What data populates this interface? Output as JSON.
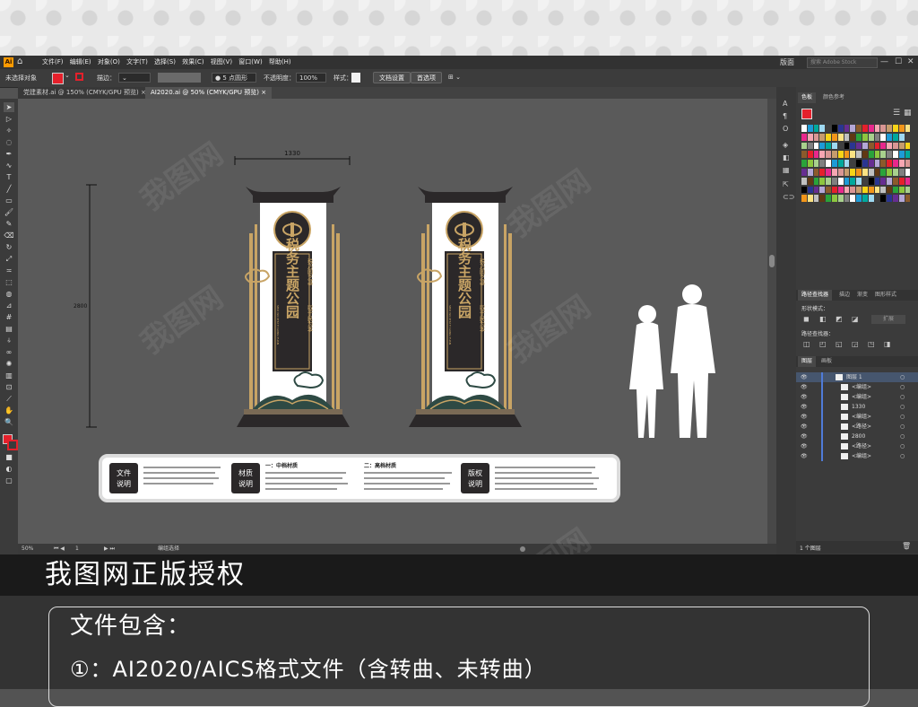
{
  "menubar": {
    "app_icon": "Ai",
    "menus": [
      "文件(F)",
      "编辑(E)",
      "对象(O)",
      "文字(T)",
      "选择(S)",
      "效果(C)",
      "视图(V)",
      "窗口(W)",
      "帮助(H)"
    ],
    "workspace": "版面",
    "stock_search_placeholder": "搜索 Adobe Stock"
  },
  "controlbar": {
    "selection_status": "未选择对象",
    "stroke_label": "描边：",
    "brush_label": "5 点圆形",
    "opacity_label": "不透明度：",
    "opacity_value": "100%",
    "style_label": "样式：",
    "doc_setup_button": "文档设置",
    "preferences_button": "首选项"
  },
  "tabs": [
    {
      "label": "党建素材.ai @ 150% (CMYK/GPU 预览)"
    },
    {
      "label": "AI2020.ai @ 50% (CMYK/GPU 预览)"
    }
  ],
  "artboard": {
    "dimension_width": "1330",
    "dimension_height": "2800",
    "sign_title": "税务主题公园",
    "sign_slogan_1": "税乃国之基",
    "sign_slogan_2": "取于民为本",
    "sign_pinyin": "SHUI WU ZHU TI GONG YUAN",
    "info_labels": [
      "文件\n说明",
      "材质\n说明",
      "版权\n说明"
    ],
    "material_mid_title": "一：中档材质",
    "material_high_title": "二：高档材质"
  },
  "statusbar": {
    "zoom": "50%",
    "page": "1",
    "tool_name": "编组选择"
  },
  "panels": {
    "swatches_tabs": [
      "色板",
      "颜色参考"
    ],
    "pathfinder_tabs": [
      "路径查找器",
      "描边",
      "渐变",
      "图形样式"
    ],
    "shape_modes_label": "形状模式：",
    "expand_button": "扩展",
    "pathfinders_label": "路径查找器：",
    "layers_tabs": [
      "图层",
      "画板"
    ],
    "layers": [
      {
        "name": "图层 1",
        "indent": 0
      },
      {
        "name": "<编组>",
        "indent": 1
      },
      {
        "name": "<编组>",
        "indent": 1
      },
      {
        "name": "1330",
        "indent": 1
      },
      {
        "name": "<编组>",
        "indent": 1
      },
      {
        "name": "<路径>",
        "indent": 1
      },
      {
        "name": "2800",
        "indent": 1
      },
      {
        "name": "<路径>",
        "indent": 1
      },
      {
        "name": "<编组>",
        "indent": 1
      }
    ],
    "layers_count": "1 个图层"
  },
  "banner": {
    "title": "我图网正版授权",
    "info_heading": "文件包含：",
    "info_line": "①：AI2020/AICS格式文件（含转曲、未转曲）"
  },
  "watermark": "我图网",
  "colors": {
    "accent_gold": "#c8a465",
    "sign_dark": "#2d2a2b",
    "mountain_teal": "#2e4a44",
    "canvas_gray": "#5a5a5a",
    "banner_black": "#1a1a1a"
  }
}
